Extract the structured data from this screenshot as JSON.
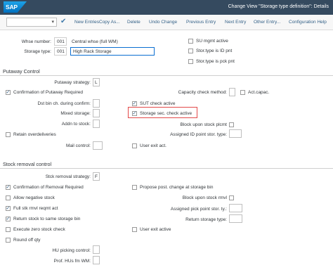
{
  "shell": {
    "logo": "SAP",
    "title": "Change View \"Storage type definition\": Details"
  },
  "toolbar": {
    "new_entries": "New Entries",
    "copy_as": "Copy As...",
    "delete": "Delete",
    "undo_change": "Undo Change",
    "previous_entry": "Previous Entry",
    "next_entry": "Next Entry",
    "other_entry": "Other Entry...",
    "configuration_help": "Configuration Help"
  },
  "header": {
    "whse_number_label": "Whse number:",
    "whse_number": "001",
    "whse_desc": "Central whse (full WM)",
    "storage_type_label": "Storage type:",
    "storage_type": "001",
    "storage_type_desc": "High Rack Storage",
    "su_mgmt_active": "SU mgmt active",
    "stor_type_id_pnt": "Stor.type is ID pnt",
    "stor_type_pck_pnt": "Stor.type is pck pnt"
  },
  "putaway": {
    "title": "Putaway Control",
    "putaway_strategy_label": "Putaway strategy:",
    "putaway_strategy": "L",
    "capacity_check_method": "Capacity check method:",
    "act_capac": "Act.capac.",
    "confirmation_required": "Confirmation of Putaway Required",
    "dst_bin_label": "Dst bin ch. during confirm:",
    "sut_check_active": "SUT check active",
    "mixed_storage": "Mixed storage:",
    "storage_sec_check_active": "Storage sec. check active",
    "addn_to_stock": "Addn to stock:",
    "block_upon_stock_plcmt": "Block upon stock plcmt",
    "retain_overdeliveries": "Retain overdeliveries",
    "assigned_id_point": "Assigned ID point stor. type:",
    "mail_control": "Mail control:",
    "user_exit_act": "User exit act."
  },
  "removal": {
    "title": "Stock removal control",
    "strategy_label": "Stck removal strategy:",
    "strategy": "F",
    "confirmation_required": "Confirmation of Removal Required",
    "propose_post_change": "Propose post. change at storage bin",
    "allow_negative_stock": "Allow negative stock",
    "block_upon_stock_rmvl": "Block upon stock rmvl",
    "full_stk_rmvl": "Full stk rmvl reqmt act",
    "assigned_pick_point": "Assigned pick point stor. ty.:",
    "return_stock": "Return stock to same storage bin",
    "return_storage_type": "Return storage type:",
    "execute_zero_stock": "Execute zero stock check",
    "user_exit_active": "User exit active",
    "round_off_qty": "Round off qty",
    "hu_picking_control": "HU picking control:",
    "prof_hus": "Prof. HUs fm WM:"
  },
  "icons": {
    "ok": "check-icon",
    "dropdown": "chevron-down-icon"
  }
}
